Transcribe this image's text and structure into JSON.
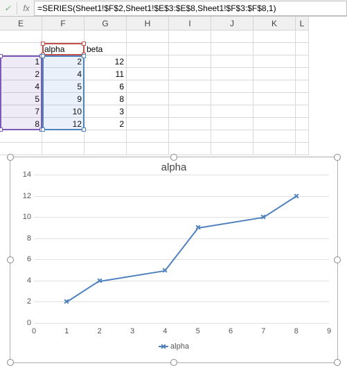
{
  "formula_bar": {
    "check": "✓",
    "fx": "fx",
    "formula": "=SERIES(Sheet1!$F$2,Sheet1!$E$3:$E$8,Sheet1!$F$3:$F$8,1)"
  },
  "columns": [
    "E",
    "F",
    "G",
    "H",
    "I",
    "J",
    "K",
    "L"
  ],
  "grid": {
    "header_row": {
      "E": "",
      "F": "alpha",
      "G": "beta"
    },
    "rows": [
      {
        "E": "1",
        "F": "2",
        "G": "12"
      },
      {
        "E": "2",
        "F": "4",
        "G": "11"
      },
      {
        "E": "4",
        "F": "5",
        "G": "6"
      },
      {
        "E": "5",
        "F": "9",
        "G": "8"
      },
      {
        "E": "7",
        "F": "10",
        "G": "3"
      },
      {
        "E": "8",
        "F": "12",
        "G": "2"
      }
    ]
  },
  "chart_data": {
    "type": "line",
    "title": "alpha",
    "x": [
      1,
      2,
      4,
      5,
      7,
      8
    ],
    "series": [
      {
        "name": "alpha",
        "values": [
          2,
          4,
          5,
          9,
          10,
          12
        ],
        "color": "#4f81bd"
      }
    ],
    "xlim": [
      0,
      9
    ],
    "ylim": [
      0,
      14
    ],
    "xticks": [
      0,
      1,
      2,
      3,
      4,
      5,
      6,
      7,
      8,
      9
    ],
    "yticks": [
      0,
      2,
      4,
      6,
      8,
      10,
      12,
      14
    ],
    "legend_position": "bottom",
    "grid": true
  }
}
